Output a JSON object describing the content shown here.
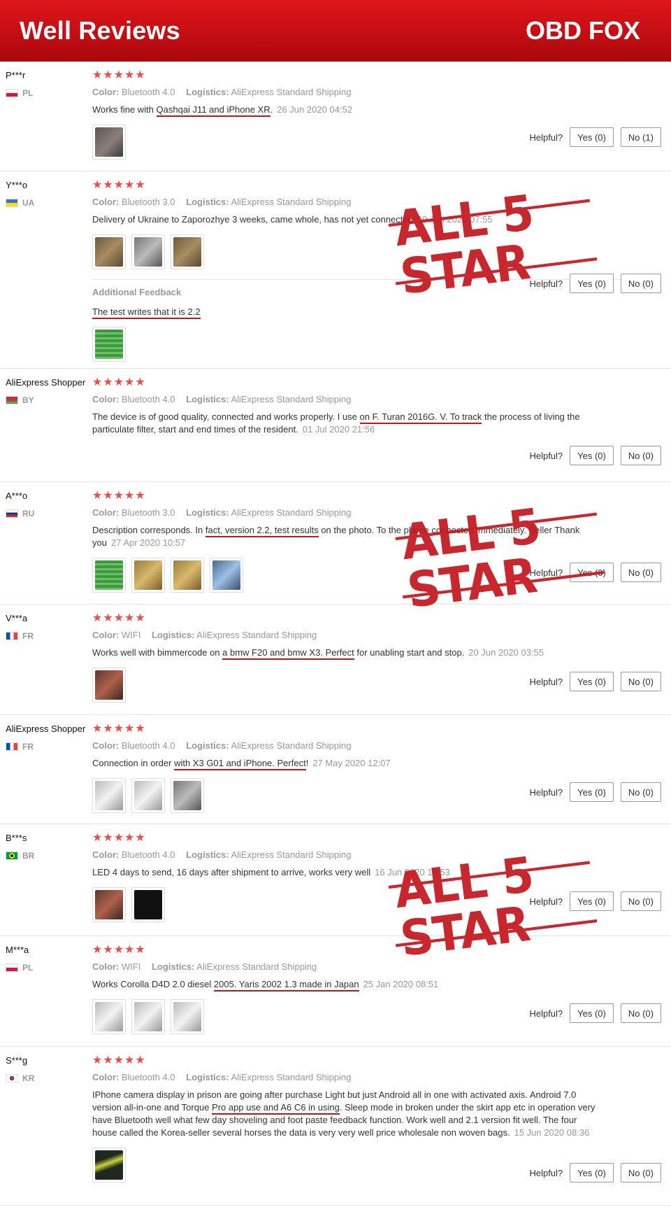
{
  "header": {
    "title": "Well Reviews",
    "brand": "OBD FOX"
  },
  "labels": {
    "color": "Color:",
    "logistics": "Logistics:",
    "helpful": "Helpful?",
    "additional_feedback": "Additional Feedback",
    "stars": "★★★★★"
  },
  "stamp_text": "ALL 5 STAR",
  "reviews": [
    {
      "user": "P***r",
      "country": "PL",
      "rating": 5,
      "color": "Bluetooth 4.0",
      "logistics": "AliExpress Standard Shipping",
      "text_pre": "Works fine with ",
      "text_ul": "Qashqai J11 and iPhone XR",
      "text_post": ".",
      "date": "26 Jun 2020 04:52",
      "yes": "Yes (0)",
      "no": "No (1)"
    },
    {
      "user": "Y***o",
      "country": "UA",
      "rating": 5,
      "color": "Bluetooth 3.0",
      "logistics": "AliExpress Standard Shipping",
      "text_pre": "Delivery of Ukraine to Zaporozhye 3 weeks, came whole, has not yet connected",
      "text_ul": "",
      "text_post": "",
      "date": "09 Jun 2020 07:55",
      "yes": "Yes (0)",
      "no": "No (0)",
      "additional_pre": "",
      "additional_ul": "The test writes that it is 2.2",
      "additional_post": ""
    },
    {
      "user": "AliExpress Shopper",
      "country": "BY",
      "rating": 5,
      "color": "Bluetooth 4.0",
      "logistics": "AliExpress Standard Shipping",
      "text_pre": "The device is of good quality, connected and works properly. I use ",
      "text_ul": "on F. Turan 2016G. V. To track",
      "text_post": " the process of living the particulate filter, start and end times of the resident.",
      "date": "01 Jul 2020 21:56",
      "yes": "Yes (0)",
      "no": "No (0)"
    },
    {
      "user": "A***o",
      "country": "RU",
      "rating": 5,
      "color": "Bluetooth 3.0",
      "logistics": "AliExpress Standard Shipping",
      "text_pre": "Description corresponds. In ",
      "text_ul": "fact, version 2.2, test results",
      "text_post": " on the photo. To the phone connected immediately. Seller Thank you",
      "date": "27 Apr 2020 10:57",
      "yes": "Yes (0)",
      "no": "No (0)"
    },
    {
      "user": "V***a",
      "country": "FR",
      "rating": 5,
      "color": "WIFI",
      "logistics": "AliExpress Standard Shipping",
      "text_pre": "Works well with bimmercode on ",
      "text_ul": "a bmw F20 and bmw X3. Perfect",
      "text_post": " for unabling start and stop.",
      "date": "20 Jun 2020 03:55",
      "yes": "Yes (0)",
      "no": "No (0)"
    },
    {
      "user": "AliExpress Shopper",
      "country": "FR",
      "rating": 5,
      "color": "Bluetooth 4.0",
      "logistics": "AliExpress Standard Shipping",
      "text_pre": "Connection in order ",
      "text_ul": "with X3 G01 and iPhone. Perfect",
      "text_post": "!",
      "date": "27 May 2020 12:07",
      "yes": "Yes (0)",
      "no": "No (0)"
    },
    {
      "user": "B***s",
      "country": "BR",
      "rating": 5,
      "color": "Bluetooth 4.0",
      "logistics": "AliExpress Standard Shipping",
      "text_pre": "LED 4 days to send, 16 days after shipment to arrive, works very well",
      "text_ul": "",
      "text_post": "",
      "date": "16 Jun 2020 19:53",
      "yes": "Yes (0)",
      "no": "No (0)"
    },
    {
      "user": "M***a",
      "country": "PL",
      "rating": 5,
      "color": "WIFI",
      "logistics": "AliExpress Standard Shipping",
      "text_pre": "Works Corolla D4D 2.0 diesel ",
      "text_ul": "2005. Yaris 2002 1.3 made in Japan",
      "text_post": "",
      "date": "25 Jan 2020 08:51",
      "yes": "Yes (0)",
      "no": "No (0)"
    },
    {
      "user": "S***g",
      "country": "KR",
      "rating": 5,
      "color": "Bluetooth 4.0",
      "logistics": "AliExpress Standard Shipping",
      "text_pre": "IPhone camera display in prison are going after purchase Light but just Android all in one with activated axis. Android 7.0 version all-in-one and Torque ",
      "text_ul": "Pro app use and A6 C6 in using",
      "text_post": ". Sleep mode in broken under the skirt app etc in operation very have Bluetooth well what few day shoveling and foot paste feedback function. Work well and 2.1 version fit well. The four house called the Korea-seller several horses the data is very very well price wholesale non woven bags.",
      "date": "15 Jun 2020 08:36",
      "yes": "Yes (0)",
      "no": "No (0)"
    }
  ]
}
